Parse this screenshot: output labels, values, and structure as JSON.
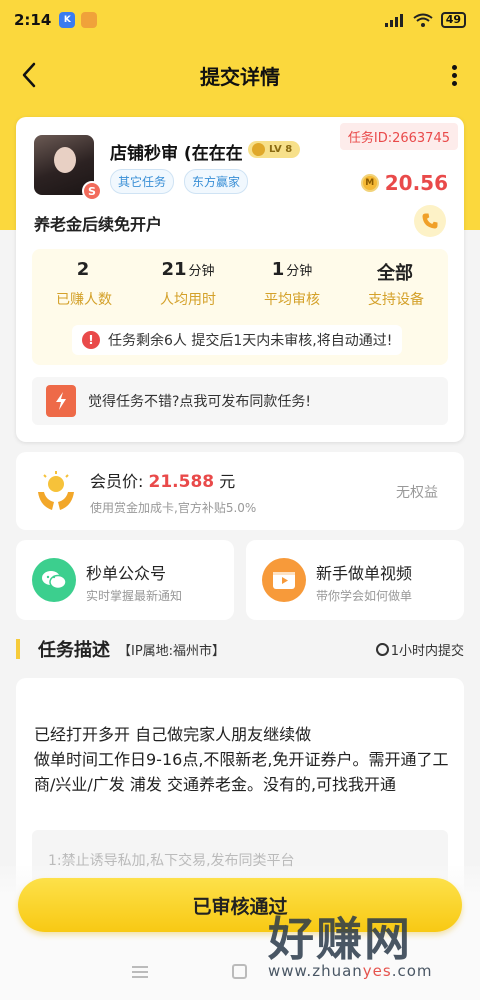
{
  "status_bar": {
    "time": "2:14",
    "battery": "49"
  },
  "nav": {
    "title": "提交详情"
  },
  "task": {
    "task_id": "任务ID:2663745",
    "shop_name": "店铺秒审 (在在在",
    "level_badge": "LV 8",
    "avatar_badge": "S",
    "tags": [
      "其它任务",
      "东方赢家"
    ],
    "reward": "20.56",
    "coin_symbol": "M",
    "title": "养老金后续免开户",
    "stats": [
      {
        "value": "2",
        "unit": "",
        "label": "已赚人数"
      },
      {
        "value": "21",
        "unit": "分钟",
        "label": "人均用时"
      },
      {
        "value": "1",
        "unit": "分钟",
        "label": "平均审核"
      },
      {
        "value": "全部",
        "unit": "",
        "label": "支持设备"
      }
    ],
    "notice": "任务剩余6人  提交后1天内未审核,将自动通过!",
    "notice_icon": "!",
    "publish_text": "觉得任务不错?点我可发布同款任务!"
  },
  "vip": {
    "label": "会员价:",
    "price": "21.588",
    "unit": "元",
    "subtitle": "使用赏金加成卡,官方补贴5.0%",
    "right_text": "无权益"
  },
  "cards": [
    {
      "title": "秒单公众号",
      "subtitle": "实时掌握最新通知",
      "icon": "wechat-icon",
      "color": "#3ccf8e"
    },
    {
      "title": "新手做单视频",
      "subtitle": "带你学会如何做单",
      "icon": "video-icon",
      "color": "#f79a3a"
    }
  ],
  "description": {
    "heading": "任务描述",
    "ip_location": "【IP属地:福州市】",
    "deadline": "1小时内提交",
    "lines": [
      "已经打开多开 自己做完家人朋友继续做",
      "做单时间工作日9-16点,不限新老,免开证券户。需开通了工商/兴业/广发 浦发 交通养老金。没有的,可找我开通"
    ],
    "rule": "1:禁止诱导私加,私下交易,发布同类平台"
  },
  "action": {
    "approve_label": "已审核通过"
  },
  "watermark": {
    "big_text": "好赚网",
    "url_prefix": "www.zhuan",
    "url_accent": "yes",
    "url_suffix": ".com"
  },
  "colors": {
    "brand_yellow": "#fbd83d",
    "price_red": "#e94a4a",
    "label_gold": "#d4a12a",
    "tag_blue": "#3a8fd6"
  }
}
